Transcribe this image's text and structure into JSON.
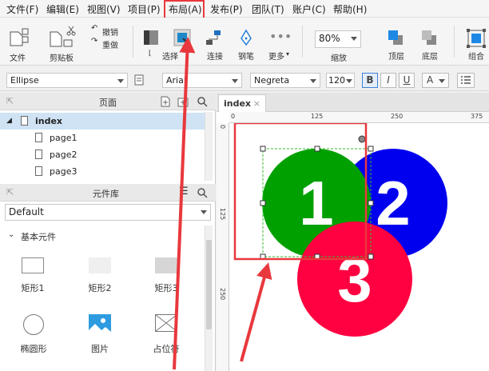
{
  "menu": {
    "items": [
      "文件(F)",
      "编辑(E)",
      "视图(V)",
      "项目(P)",
      "布局(A)",
      "发布(P)",
      "团队(T)",
      "账户(C)",
      "帮助(H)"
    ]
  },
  "toolbar": {
    "file": "文件",
    "clipboard": "剪贴板",
    "undo": "撤销",
    "redo": "重做",
    "select": "选择",
    "connect": "连接",
    "pen": "钢笔",
    "more": "更多",
    "zoom_value": "80%",
    "zoom": "缩放",
    "top": "顶层",
    "bottom": "底层",
    "group": "组合"
  },
  "format": {
    "shape": "Ellipse",
    "font": "Arial",
    "weight": "Negreta",
    "size": "120",
    "bold": "B",
    "italic": "I",
    "underline": "U",
    "font_color": "A"
  },
  "pages_panel": {
    "title": "页面",
    "root": "index",
    "pages": [
      "page1",
      "page2",
      "page3"
    ]
  },
  "library_panel": {
    "title": "元件库",
    "selected": "Default",
    "section": "基本元件",
    "items": [
      "矩形1",
      "矩形2",
      "矩形3",
      "椭圆形",
      "图片",
      "占位符"
    ]
  },
  "canvas": {
    "tab": "index",
    "ruler_h": [
      "0",
      "125",
      "250",
      "375"
    ],
    "ruler_v": [
      "0",
      "125",
      "250"
    ],
    "circles": [
      {
        "label": "1",
        "color": "#00a000"
      },
      {
        "label": "2",
        "color": "#0000ee"
      },
      {
        "label": "3",
        "color": "#ff0040"
      }
    ]
  },
  "colors": {
    "highlight": "#e8383d",
    "selection": "#3d9be9"
  }
}
